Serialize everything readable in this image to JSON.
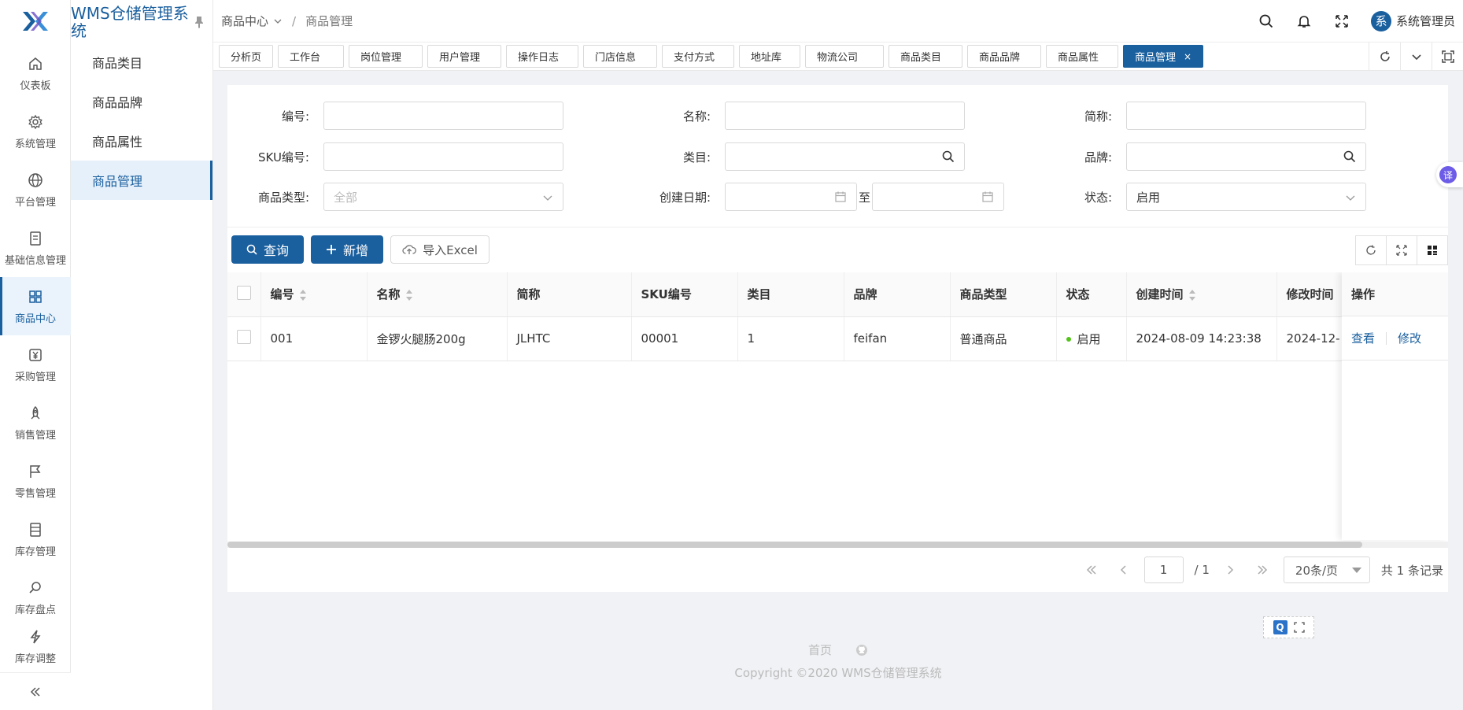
{
  "app": {
    "title": "WMS仓储管理系统"
  },
  "sidebar": {
    "items": [
      {
        "label": "仪表板",
        "icon": "home-icon"
      },
      {
        "label": "系统管理",
        "icon": "gear-icon"
      },
      {
        "label": "平台管理",
        "icon": "globe-icon"
      },
      {
        "label": "基础信息管理",
        "icon": "document-icon"
      },
      {
        "label": "商品中心",
        "icon": "grid-icon"
      },
      {
        "label": "采购管理",
        "icon": "yen-icon"
      },
      {
        "label": "销售管理",
        "icon": "rocket-icon"
      },
      {
        "label": "零售管理",
        "icon": "flag-icon"
      },
      {
        "label": "库存管理",
        "icon": "list-icon"
      },
      {
        "label": "库存盘点",
        "icon": "search-doc-icon"
      },
      {
        "label": "库存调整",
        "icon": "bolt-icon"
      }
    ]
  },
  "submenu": {
    "items": [
      {
        "label": "商品类目"
      },
      {
        "label": "商品品牌"
      },
      {
        "label": "商品属性"
      },
      {
        "label": "商品管理"
      }
    ]
  },
  "header": {
    "breadcrumb": {
      "parent": "商品中心",
      "current": "商品管理"
    },
    "user": {
      "avatar_char": "系",
      "name": "系统管理员"
    }
  },
  "tabs": [
    {
      "label": "分析页"
    },
    {
      "label": "工作台"
    },
    {
      "label": "岗位管理"
    },
    {
      "label": "用户管理"
    },
    {
      "label": "操作日志"
    },
    {
      "label": "门店信息"
    },
    {
      "label": "支付方式"
    },
    {
      "label": "地址库"
    },
    {
      "label": "物流公司"
    },
    {
      "label": "商品类目"
    },
    {
      "label": "商品品牌"
    },
    {
      "label": "商品属性"
    },
    {
      "label": "商品管理",
      "closable": "×"
    }
  ],
  "form": {
    "code": {
      "label": "编号:",
      "value": ""
    },
    "name": {
      "label": "名称:",
      "value": ""
    },
    "short_name": {
      "label": "简称:",
      "value": ""
    },
    "sku": {
      "label": "SKU编号:",
      "value": ""
    },
    "category": {
      "label": "类目:",
      "value": ""
    },
    "brand": {
      "label": "品牌:",
      "value": ""
    },
    "product_type": {
      "label": "商品类型:",
      "placeholder": "全部"
    },
    "created_date": {
      "label": "创建日期:",
      "to": "至"
    },
    "status": {
      "label": "状态:",
      "value": "启用"
    }
  },
  "toolbar": {
    "query_label": "查询",
    "add_label": "新增",
    "import_label": "导入Excel"
  },
  "table": {
    "columns": [
      "编号",
      "名称",
      "简称",
      "SKU编号",
      "类目",
      "品牌",
      "商品类型",
      "状态",
      "创建时间",
      "修改时间"
    ],
    "op_header": "操作",
    "rows": [
      {
        "code": "001",
        "name": "金锣火腿肠200g",
        "short_name": "JLHTC",
        "sku": "00001",
        "category": "1",
        "brand": "feifan",
        "type": "普通商品",
        "status": "启用",
        "created": "2024-08-09 14:23:38",
        "modified": "2024-12-",
        "ops": {
          "view": "查看",
          "edit": "修改"
        }
      }
    ]
  },
  "pager": {
    "current": "1",
    "total_pages": "/ 1",
    "page_size": "20条/页",
    "total": "共 1 条记录"
  },
  "footer": {
    "home": "首页",
    "copyright": "Copyright ©2020 WMS仓储管理系统"
  },
  "translate": {
    "label": "译"
  },
  "colors": {
    "primary": "#1a5f9e",
    "status_green": "#52c41a"
  }
}
